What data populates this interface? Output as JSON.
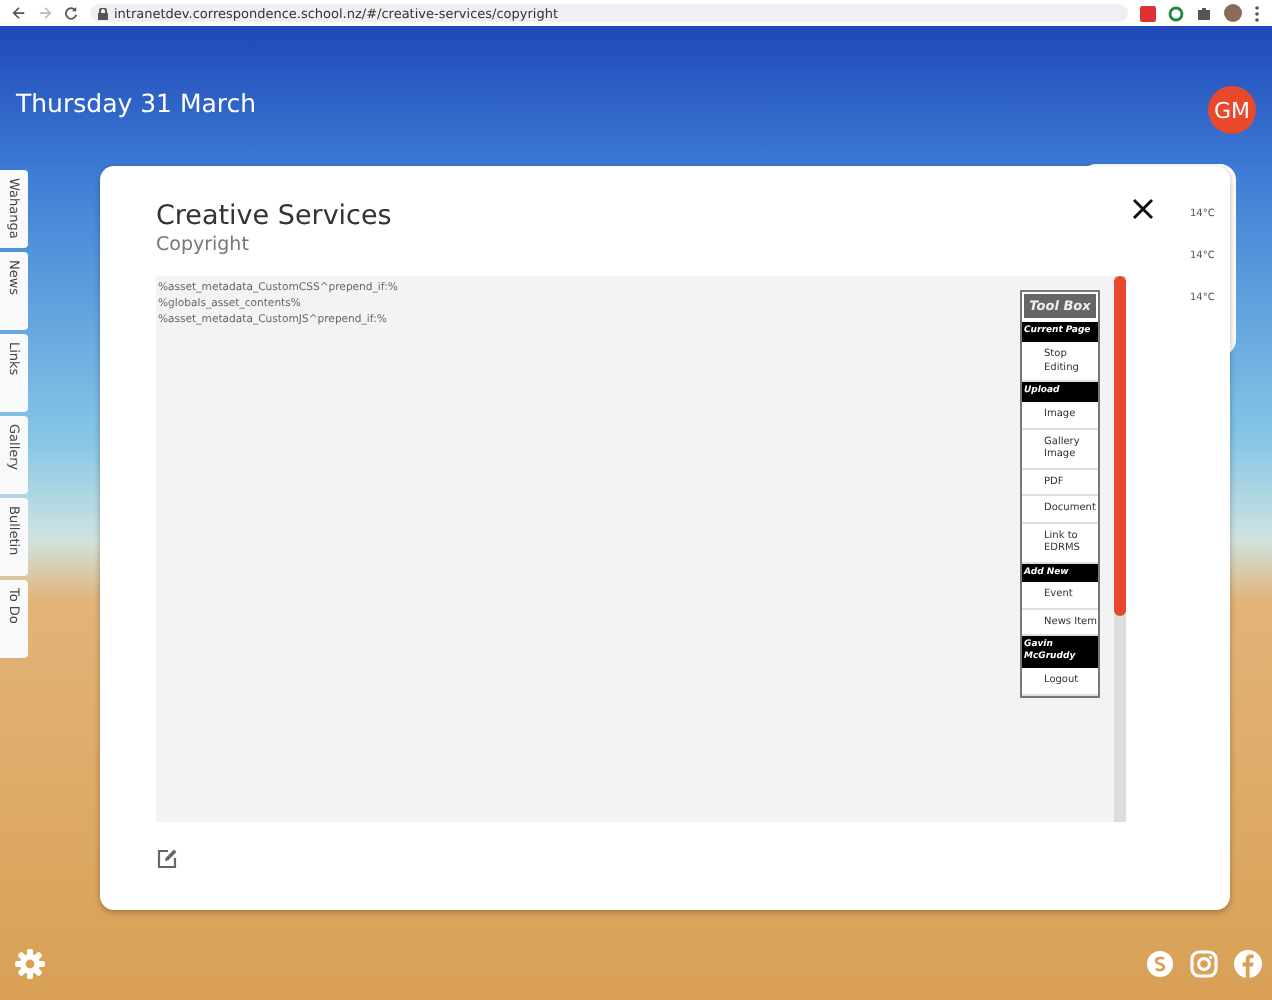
{
  "browser": {
    "url": "intranetdev.correspondence.school.nz/#/creative-services/copyright"
  },
  "header": {
    "date": "Thursday 31 March",
    "avatar": "GM"
  },
  "side_tabs": [
    {
      "label": "Wahanga"
    },
    {
      "label": "News"
    },
    {
      "label": "Links"
    },
    {
      "label": "Gallery"
    },
    {
      "label": "Bulletin"
    },
    {
      "label": "To Do"
    }
  ],
  "weather": [
    "14°C",
    "14°C",
    "14°C"
  ],
  "modal": {
    "title": "Creative Services",
    "subtitle": "Copyright",
    "content_lines": [
      "%asset_metadata_CustomCSS^prepend_if:%",
      "%globals_asset_contents%",
      "%asset_metadata_CustomJS^prepend_if:%"
    ],
    "toolbox": {
      "title": "Tool Box",
      "sections": [
        {
          "heading": "Current Page",
          "items": [
            "Stop Editing"
          ]
        },
        {
          "heading": "Upload",
          "items": [
            "Image",
            "Gallery Image",
            "PDF",
            "Document",
            "Link to EDRMS"
          ]
        },
        {
          "heading": "Add New",
          "items": [
            "Event",
            "News Item"
          ]
        },
        {
          "heading": "Gavin McGruddy",
          "items": [
            "Logout"
          ]
        }
      ]
    }
  }
}
